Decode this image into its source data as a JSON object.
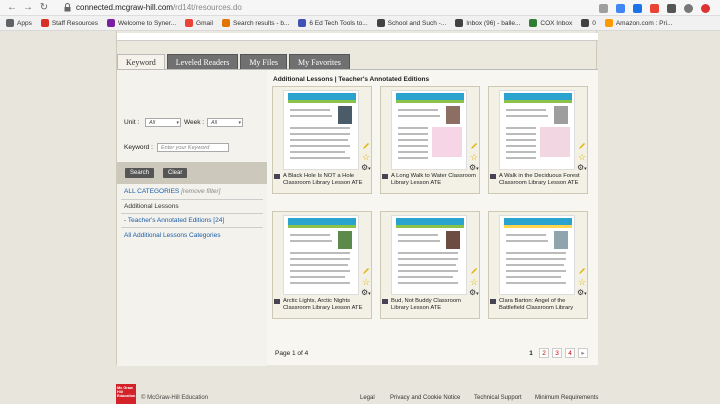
{
  "browser": {
    "url_host": "connected.mcgraw-hill.com",
    "url_path": "/rd14t/resources.do",
    "bookmarks": [
      {
        "label": "Apps",
        "color": "#5f6368"
      },
      {
        "label": "Staff Resources",
        "color": "#d93025"
      },
      {
        "label": "Welcome to Syner...",
        "color": "#7b1fa2"
      },
      {
        "label": "Gmail",
        "color": "#ea4335"
      },
      {
        "label": "Search results - b...",
        "color": "#e37400"
      },
      {
        "label": "6 Ed Tech Tools to...",
        "color": "#3f51b5"
      },
      {
        "label": "School and Such -...",
        "color": "#424242"
      },
      {
        "label": "Inbox (96) - balle...",
        "color": "#424242"
      },
      {
        "label": "COX Inbox",
        "color": "#2e7d32"
      },
      {
        "label": "0",
        "color": "#424242"
      },
      {
        "label": "Amazon.com : Pri...",
        "color": "#ff9900"
      }
    ]
  },
  "tabs": [
    "Keyword",
    "Leveled Readers",
    "My Files",
    "My Favorites"
  ],
  "filters": {
    "unit_label": "Unit :",
    "unit_value": "All",
    "week_label": "Week :",
    "week_value": "All",
    "keyword_label": "Keyword :",
    "keyword_placeholder": "Enter your Keyword",
    "search_label": "Search",
    "clear_label": "Clear"
  },
  "categories": {
    "all_label": "ALL CATEGORIES",
    "remove_filter": "[remove filter]",
    "current": "Additional Lessons",
    "subitem": "- Teacher's Annotated Editions [24]",
    "all_additional": "All Additional Lessons Categories"
  },
  "results": {
    "heading": "Additional Lessons | Teacher's Annotated Editions",
    "items": [
      {
        "title": "A Black Hole Is NOT a Hole Classroom Library Lesson ATE"
      },
      {
        "title": "A Long Walk to Water Classroom Library Lesson ATE"
      },
      {
        "title": "A Walk in the Deciduous Forest Classroom Library Lesson ATE"
      },
      {
        "title": "Arctic Lights, Arctic Nights Classroom Library Lesson ATE"
      },
      {
        "title": "Bud, Not Buddy Classroom Library Lesson ATE"
      },
      {
        "title": "Clara Barton: Angel of the Battlefield Classroom Library"
      }
    ],
    "page_info": "Page 1 of 4",
    "pages": [
      "1",
      "2",
      "3",
      "4",
      "▸"
    ]
  },
  "footer": {
    "logo_text": "Mc Graw Hill Education",
    "copyright": "© McGraw-Hill Education",
    "links": [
      "Legal",
      "Privacy and Cookie Notice",
      "Technical Support",
      "Minimum Requirements"
    ]
  },
  "colors": {
    "link_blue": "#1b5ea8",
    "tab_gray": "#707070",
    "brand_red": "#d32228"
  }
}
